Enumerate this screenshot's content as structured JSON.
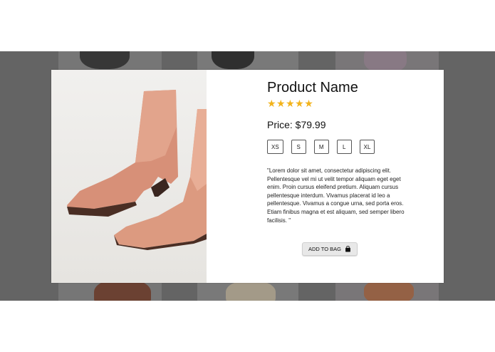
{
  "product": {
    "name": "Product Name",
    "stars": "★★★★★",
    "rating": 5,
    "rating_max": 5,
    "price": "Price: $79.99",
    "sizes": [
      "XS",
      "S",
      "M",
      "L",
      "XL"
    ],
    "description": "\"Lorem dolor sit amet, consectetur adipiscing elit. Pellentesque vel mi ut velit tempor aliquam eget eget enim. Proin cursus eleifend pretium. Aliquam cursus pellentesque interdum. Vivamus placerat id leo a pellentesque. Vivamus a congue urna, sed porta eros. Etiam finibus magna et est aliquam, sed semper libero facilisis. \"",
    "add_to_bag_label": "ADD TO BAG",
    "image_alt_icon": "ankle-boot-photo"
  },
  "colors": {
    "star": "#f2b31b",
    "overlay": "#6f6f6f",
    "boot": "#d9937a",
    "sole": "#4a2e24"
  }
}
